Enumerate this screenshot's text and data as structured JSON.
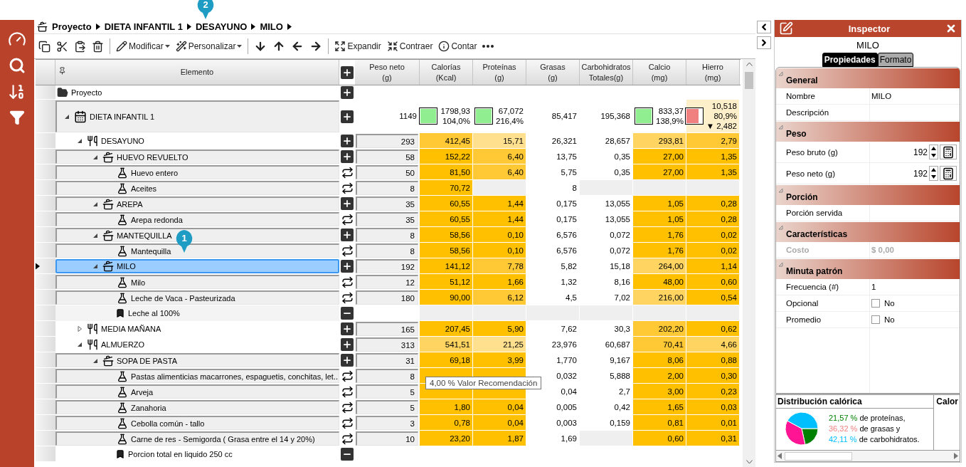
{
  "breadcrumb": [
    "Proyecto",
    "DIETA INFANTIL 1",
    "DESAYUNO",
    "MILO"
  ],
  "toolbar": [
    {
      "label": "Modificar",
      "dropdown": true
    },
    {
      "label": "Personalizar",
      "dropdown": true
    },
    {
      "label": "Expandir",
      "dropdown": false
    },
    {
      "label": "Contraer",
      "dropdown": false
    },
    {
      "label": "Contar",
      "dropdown": false
    }
  ],
  "table": {
    "element_header": "Elemento",
    "columns": [
      [
        "Peso neto",
        "(g)"
      ],
      [
        "Calorías",
        "(Kcal)"
      ],
      [
        "Proteínas",
        "(g)"
      ],
      [
        "Grasas",
        "(g)"
      ],
      [
        "Carbohidratos",
        "Totales(g)"
      ],
      [
        "Calcio",
        "(mg)"
      ],
      [
        "Hierro",
        "(mg)"
      ]
    ],
    "rows": [
      {
        "label": "Proyecto",
        "kind": "folder",
        "button": {
          "kind": "add"
        },
        "selected": false,
        "children": [
          {
            "label": "DIETA INFANTIL 1",
            "kind": "plan",
            "button": {
              "kind": "add"
            },
            "selected": false,
            "expanded": true,
            "cells": [
              {
                "lines": [
                  "1149"
                ]
              },
              {
                "lines": [
                  "1798,93",
                  "104,0%"
                ],
                "indicator": {
                  "color": "#90ee90",
                  "level": 1
                }
              },
              {
                "lines": [
                  "67,072",
                  "216,4%"
                ],
                "indicator": {
                  "color": "#90ee90",
                  "level": 1
                }
              },
              {
                "lines": [
                  "85,417"
                ]
              },
              {
                "lines": [
                  "195,368"
                ]
              },
              {
                "lines": [
                  "833,37",
                  "138,9%"
                ],
                "indicator": {
                  "color": "#90ee90",
                  "level": 1
                }
              },
              {
                "lines": [
                  "10,518",
                  "80,9%",
                  "▼ 2,482"
                ],
                "color": "#fdefc9",
                "indicator": {
                  "color": "#f08080",
                  "level": 0.81
                }
              }
            ],
            "children": [
              {
                "label": "DESAYUNO",
                "kind": "meal",
                "button": {
                  "kind": "add"
                },
                "selected": false,
                "expanded": true,
                "cells": [
                  {
                    "text": "293"
                  },
                  {
                    "text": "412,45",
                    "color": "#ffc935"
                  },
                  {
                    "text": "15,71",
                    "color": "#ffe08e"
                  },
                  {
                    "text": "26,321"
                  },
                  {
                    "text": "28,657"
                  },
                  {
                    "text": "293,81",
                    "color": "#ffd460"
                  },
                  {
                    "text": "2,79",
                    "color": "#ffc935"
                  }
                ],
                "children": [
                  {
                    "label": "HUEVO REVUELTO",
                    "kind": "recipe",
                    "button": {
                      "kind": "add"
                    },
                    "selected": false,
                    "expanded": true,
                    "cells": [
                      {
                        "text": "58"
                      },
                      {
                        "text": "152,22",
                        "color": "#ffc000"
                      },
                      {
                        "text": "6,40",
                        "color": "#ffc935"
                      },
                      {
                        "text": "13,75"
                      },
                      {
                        "text": "0,35"
                      },
                      {
                        "text": "27,00",
                        "color": "#ffc000"
                      },
                      {
                        "text": "1,35",
                        "color": "#ffc000"
                      }
                    ],
                    "children": [
                      {
                        "label": "Huevo entero",
                        "kind": "ingredient",
                        "button": {
                          "kind": "swap"
                        },
                        "selected": false,
                        "cells": [
                          {
                            "text": "50"
                          },
                          {
                            "text": "81,50",
                            "color": "#ffc000"
                          },
                          {
                            "text": "6,40",
                            "color": "#ffc935"
                          },
                          {
                            "text": "5,75"
                          },
                          {
                            "text": "0,35"
                          },
                          {
                            "text": "27,00",
                            "color": "#ffc000"
                          },
                          {
                            "text": "1,35",
                            "color": "#ffc000"
                          }
                        ]
                      },
                      {
                        "label": "Aceites",
                        "kind": "ingredient",
                        "button": {
                          "kind": "swap"
                        },
                        "selected": false,
                        "cells": [
                          {
                            "text": "8"
                          },
                          {
                            "text": "70,72",
                            "color": "#ffc000"
                          },
                          {
                            "color": "#efefef"
                          },
                          {
                            "text": "8"
                          },
                          {
                            "color": "#efefef"
                          },
                          {
                            "color": "#efefef"
                          },
                          {
                            "color": "#efefef"
                          }
                        ]
                      }
                    ]
                  },
                  {
                    "label": "AREPA",
                    "kind": "recipe",
                    "button": {
                      "kind": "add"
                    },
                    "selected": false,
                    "expanded": true,
                    "cells": [
                      {
                        "text": "35"
                      },
                      {
                        "text": "60,55",
                        "color": "#ffc000"
                      },
                      {
                        "text": "1,44",
                        "color": "#ffc000"
                      },
                      {
                        "text": "0,175"
                      },
                      {
                        "text": "13,055"
                      },
                      {
                        "text": "1,05",
                        "color": "#ffc000"
                      },
                      {
                        "text": "0,28",
                        "color": "#ffc000"
                      }
                    ],
                    "children": [
                      {
                        "label": "Arepa redonda",
                        "kind": "ingredient",
                        "button": {
                          "kind": "swap"
                        },
                        "selected": false,
                        "cells": [
                          {
                            "text": "35"
                          },
                          {
                            "text": "60,55",
                            "color": "#ffc000"
                          },
                          {
                            "text": "1,44",
                            "color": "#ffc000"
                          },
                          {
                            "text": "0,175"
                          },
                          {
                            "text": "13,055"
                          },
                          {
                            "text": "1,05",
                            "color": "#ffc000"
                          },
                          {
                            "text": "0,28",
                            "color": "#ffc000"
                          }
                        ]
                      }
                    ]
                  },
                  {
                    "label": "MANTEQUILLA",
                    "kind": "recipe",
                    "button": {
                      "kind": "add"
                    },
                    "selected": false,
                    "expanded": true,
                    "cells": [
                      {
                        "text": "8"
                      },
                      {
                        "text": "58,56",
                        "color": "#ffc000"
                      },
                      {
                        "text": "0,10",
                        "color": "#ffc000"
                      },
                      {
                        "text": "6,576"
                      },
                      {
                        "text": "0,072"
                      },
                      {
                        "text": "1,76",
                        "color": "#ffc000"
                      },
                      {
                        "text": "0,02",
                        "color": "#ffc000"
                      }
                    ],
                    "children": [
                      {
                        "label": "Mantequilla",
                        "kind": "ingredient",
                        "button": {
                          "kind": "swap"
                        },
                        "selected": false,
                        "cells": [
                          {
                            "text": "8"
                          },
                          {
                            "text": "58,56",
                            "color": "#ffc000"
                          },
                          {
                            "text": "0,10",
                            "color": "#ffc000"
                          },
                          {
                            "text": "6,576"
                          },
                          {
                            "text": "0,072"
                          },
                          {
                            "text": "1,76",
                            "color": "#ffc000"
                          },
                          {
                            "text": "0,02",
                            "color": "#ffc000"
                          }
                        ]
                      }
                    ]
                  },
                  {
                    "label": "MILO",
                    "kind": "recipe",
                    "button": {
                      "kind": "add"
                    },
                    "selected": true,
                    "expanded": true,
                    "cells": [
                      {
                        "text": "192"
                      },
                      {
                        "text": "141,12",
                        "color": "#ffc000"
                      },
                      {
                        "text": "7,78",
                        "color": "#ffc935"
                      },
                      {
                        "text": "5,82"
                      },
                      {
                        "text": "15,18"
                      },
                      {
                        "text": "264,00",
                        "color": "#ffd460"
                      },
                      {
                        "text": "1,14",
                        "color": "#ffc000"
                      }
                    ],
                    "children": [
                      {
                        "label": "Milo",
                        "kind": "ingredient",
                        "button": {
                          "kind": "swap"
                        },
                        "selected": false,
                        "cells": [
                          {
                            "text": "12"
                          },
                          {
                            "text": "51,12",
                            "color": "#ffc000"
                          },
                          {
                            "text": "1,66",
                            "color": "#ffc000"
                          },
                          {
                            "text": "1,32"
                          },
                          {
                            "text": "8,16"
                          },
                          {
                            "text": "48,00",
                            "color": "#ffc000"
                          },
                          {
                            "text": "0,60",
                            "color": "#ffc000"
                          }
                        ]
                      },
                      {
                        "label": "Leche de Vaca - Pasteurizada",
                        "kind": "ingredient",
                        "button": {
                          "kind": "swap"
                        },
                        "selected": false,
                        "cells": [
                          {
                            "text": "180"
                          },
                          {
                            "text": "90,00",
                            "color": "#ffc000"
                          },
                          {
                            "text": "6,12",
                            "color": "#ffc935"
                          },
                          {
                            "text": "4,5"
                          },
                          {
                            "text": "7,02"
                          },
                          {
                            "text": "216,00",
                            "color": "#ffd460"
                          },
                          {
                            "text": "0,54",
                            "color": "#ffc000"
                          }
                        ]
                      },
                      {
                        "label": "Leche al 100%",
                        "kind": "note",
                        "button": {
                          "kind": "remove"
                        },
                        "selected": false,
                        "cells": [
                          {},
                          {
                            "color": "#efefef"
                          },
                          {
                            "color": "#efefef"
                          },
                          {
                            "color": "#efefef"
                          },
                          {
                            "color": "#efefef"
                          },
                          {
                            "color": "#efefef"
                          },
                          {
                            "color": "#efefef"
                          }
                        ]
                      }
                    ]
                  }
                ]
              },
              {
                "label": "MEDIA MAÑANA",
                "kind": "meal",
                "button": {
                  "kind": "add"
                },
                "selected": false,
                "expanded": false,
                "cells": [
                  {
                    "text": "165"
                  },
                  {
                    "text": "207,45",
                    "color": "#ffc000"
                  },
                  {
                    "text": "5,90",
                    "color": "#ffc000"
                  },
                  {
                    "text": "7,62"
                  },
                  {
                    "text": "30,3"
                  },
                  {
                    "text": "202,20",
                    "color": "#ffc935"
                  },
                  {
                    "text": "0,62",
                    "color": "#ffc000"
                  }
                ]
              },
              {
                "label": "ALMUERZO",
                "kind": "meal",
                "button": {
                  "kind": "add"
                },
                "selected": false,
                "expanded": true,
                "cells": [
                  {
                    "text": "313"
                  },
                  {
                    "text": "541,51",
                    "color": "#ffd460"
                  },
                  {
                    "text": "21,25",
                    "color": "#ffe08e"
                  },
                  {
                    "text": "23,976"
                  },
                  {
                    "text": "60,687"
                  },
                  {
                    "text": "70,41",
                    "color": "#ffc935"
                  },
                  {
                    "text": "4,66",
                    "color": "#ffd460"
                  }
                ],
                "children": [
                  {
                    "label": "SOPA DE PASTA",
                    "kind": "recipe",
                    "button": {
                      "kind": "add"
                    },
                    "selected": false,
                    "expanded": true,
                    "cells": [
                      {
                        "text": "31"
                      },
                      {
                        "text": "69,18",
                        "color": "#ffc000"
                      },
                      {
                        "text": "3,99",
                        "color": "#ffc000"
                      },
                      {
                        "text": "1,770"
                      },
                      {
                        "text": "9,167"
                      },
                      {
                        "text": "8,06",
                        "color": "#ffc000"
                      },
                      {
                        "text": "0,88",
                        "color": "#ffc000"
                      }
                    ],
                    "children": [
                      {
                        "label": "Pastas alimenticias macarrones, espaguetis, conchitas, let...",
                        "kind": "ingredient",
                        "button": {
                          "kind": "swap"
                        },
                        "selected": false,
                        "cells": [
                          {
                            "text": "8"
                          },
                          {
                            "color": "#ffc000"
                          },
                          {
                            "color": "#ffc000"
                          },
                          {
                            "text": "0,032"
                          },
                          {
                            "text": "5,888"
                          },
                          {
                            "text": "2,00",
                            "color": "#ffc000"
                          },
                          {
                            "text": "0,30",
                            "color": "#ffc000"
                          }
                        ]
                      },
                      {
                        "label": "Arveja",
                        "kind": "ingredient",
                        "button": {
                          "kind": "swap"
                        },
                        "selected": false,
                        "cells": [
                          {
                            "text": "5"
                          },
                          {
                            "color": "#ffc000"
                          },
                          {
                            "color": "#ffc000"
                          },
                          {
                            "text": "0,04"
                          },
                          {
                            "text": "2,7"
                          },
                          {
                            "text": "3,00",
                            "color": "#ffc000"
                          },
                          {
                            "text": "0,23",
                            "color": "#ffc000"
                          }
                        ]
                      },
                      {
                        "label": "Zanahoria",
                        "kind": "ingredient",
                        "button": {
                          "kind": "swap"
                        },
                        "selected": false,
                        "cells": [
                          {
                            "text": "5"
                          },
                          {
                            "text": "1,80",
                            "color": "#ffc000"
                          },
                          {
                            "text": "0,04",
                            "color": "#ffc000"
                          },
                          {
                            "text": "0,005"
                          },
                          {
                            "text": "0,42"
                          },
                          {
                            "text": "1,65",
                            "color": "#ffc000"
                          },
                          {
                            "text": "0,03",
                            "color": "#ffc000"
                          }
                        ]
                      },
                      {
                        "label": "Cebolla común - tallo",
                        "kind": "ingredient",
                        "button": {
                          "kind": "swap"
                        },
                        "selected": false,
                        "cells": [
                          {
                            "text": "3"
                          },
                          {
                            "text": "0,78",
                            "color": "#ffc000"
                          },
                          {
                            "text": "0,04",
                            "color": "#ffc000"
                          },
                          {
                            "text": "0,003"
                          },
                          {
                            "text": "0,159"
                          },
                          {
                            "text": "0,81",
                            "color": "#ffc000"
                          },
                          {
                            "text": "0,01",
                            "color": "#ffc000"
                          }
                        ]
                      },
                      {
                        "label": "Carne de res - Semigorda ( Grasa entre el 14 y 20%)",
                        "kind": "ingredient",
                        "button": {
                          "kind": "swap"
                        },
                        "selected": false,
                        "cells": [
                          {
                            "text": "10"
                          },
                          {
                            "text": "23,20",
                            "color": "#ffc000"
                          },
                          {
                            "text": "1,87",
                            "color": "#ffc000"
                          },
                          {
                            "text": "1,69"
                          },
                          {
                            "color": "#efefef"
                          },
                          {
                            "text": "0,60",
                            "color": "#ffc000"
                          },
                          {
                            "text": "0,31",
                            "color": "#ffc000"
                          }
                        ]
                      },
                      {
                        "label": "Porcion total en liquido 250 cc",
                        "kind": "note",
                        "button": {
                          "kind": "remove"
                        },
                        "selected": false
                      }
                    ]
                  }
                ]
              }
            ]
          }
        ]
      }
    ]
  },
  "tooltip": "4,00 % Valor Recomendación",
  "callouts": [
    "1",
    "2"
  ],
  "inspector": {
    "title": "Inspector",
    "subject": "MILO",
    "tabs": [
      {
        "label": "Propiedades",
        "selected": true
      },
      {
        "label": "Formato",
        "selected": false
      }
    ],
    "sections": [
      {
        "title": "General",
        "expanded": true,
        "properties": [
          {
            "kind": "text",
            "label": "Nombre",
            "value": "MILO",
            "disabled": false
          },
          {
            "kind": "text",
            "label": "Descripción",
            "disabled": false
          }
        ]
      },
      {
        "title": "Peso",
        "expanded": true,
        "properties": [
          {
            "kind": "number",
            "label": "Peso bruto (g)",
            "value": "192",
            "disabled": false
          },
          {
            "kind": "number",
            "label": "Peso neto (g)",
            "value": "192",
            "disabled": false
          }
        ]
      },
      {
        "title": "Porción",
        "expanded": true,
        "properties": [
          {
            "kind": "text",
            "label": "Porción servida",
            "disabled": false
          }
        ]
      },
      {
        "title": "Características",
        "expanded": true,
        "properties": [
          {
            "kind": "text",
            "label": "Costo",
            "value": "$ 0,00",
            "disabled": true
          }
        ]
      },
      {
        "title": "Minuta patrón",
        "expanded": true,
        "properties": [
          {
            "kind": "text",
            "label": "Frecuencia (#)",
            "value": "1",
            "disabled": false
          },
          {
            "kind": "checkbox",
            "label": "Opcional",
            "value": "No",
            "checked": false,
            "disabled": false
          },
          {
            "kind": "checkbox",
            "label": "Promedio",
            "value": "No",
            "checked": false,
            "disabled": false
          }
        ]
      }
    ]
  },
  "distribution": {
    "title": "Distribución calórica",
    "legend": [
      {
        "value": "21,57",
        "unit": "%",
        "text": "de proteínas,",
        "color": "#008000"
      },
      {
        "value": "36,32",
        "unit": "%",
        "text": "de grasas y",
        "color": "#f08080"
      },
      {
        "value": "42,11",
        "unit": "%",
        "text": "de carbohidratos.",
        "color": "#00bfff"
      }
    ],
    "slices": [
      {
        "color": "#008000"
      },
      {
        "color": "#ff1493"
      },
      {
        "color": "#00bfff"
      }
    ],
    "chart_data": {
      "type": "pie",
      "values": [
        21.57,
        36.32,
        42.11
      ]
    }
  },
  "side_panel": {
    "title": "Calor"
  }
}
